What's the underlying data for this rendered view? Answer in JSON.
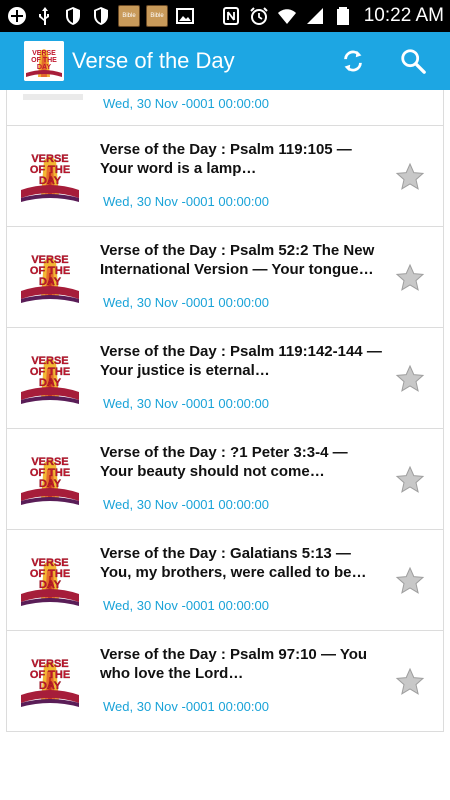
{
  "status_bar": {
    "time": "10:22 AM",
    "left_icons": [
      "add-icon",
      "usb-icon",
      "shield-icon",
      "shield-icon",
      "bible-thumb",
      "bible-thumb",
      "image-icon"
    ],
    "right_icons": [
      "nfc-icon",
      "alarm-icon",
      "wifi-icon",
      "signal-icon",
      "battery-icon"
    ],
    "thumb_label": "Bible"
  },
  "app_bar": {
    "title": "Verse of the Day",
    "logo_text": "VERSE OF THE DAY",
    "actions": [
      "refresh-icon",
      "search-icon"
    ],
    "color": "#1da6e3"
  },
  "partial_item": {
    "date": "Wed, 30 Nov -0001 00:00:00"
  },
  "items": [
    {
      "title": "Verse of the Day : Psalm 119:105 — Your word is a lamp…",
      "date": "Wed, 30 Nov -0001 00:00:00",
      "favorite": false
    },
    {
      "title": "Verse of the Day : Psalm 52:2 The New International Version — Your tongue…",
      "date": "Wed, 30 Nov -0001 00:00:00",
      "favorite": false
    },
    {
      "title": "Verse of the Day : Psalm 119:142-144 — Your justice is eternal…",
      "date": "Wed, 30 Nov -0001 00:00:00",
      "favorite": false
    },
    {
      "title": "Verse of the Day : ?1 Peter 3:3-4 — Your beauty should not come…",
      "date": "Wed, 30 Nov -0001 00:00:00",
      "favorite": false
    },
    {
      "title": "Verse of the Day : Galatians 5:13 — You, my brothers, were called to be…",
      "date": "Wed, 30 Nov -0001 00:00:00",
      "favorite": false
    },
    {
      "title": "Verse of the Day : Psalm 97:10 — You who love the Lord…",
      "date": "Wed, 30 Nov -0001 00:00:00",
      "favorite": false
    }
  ],
  "colors": {
    "accent": "#1da6e3",
    "date_text": "#1aa3d8",
    "star": "#c8c8c8"
  }
}
